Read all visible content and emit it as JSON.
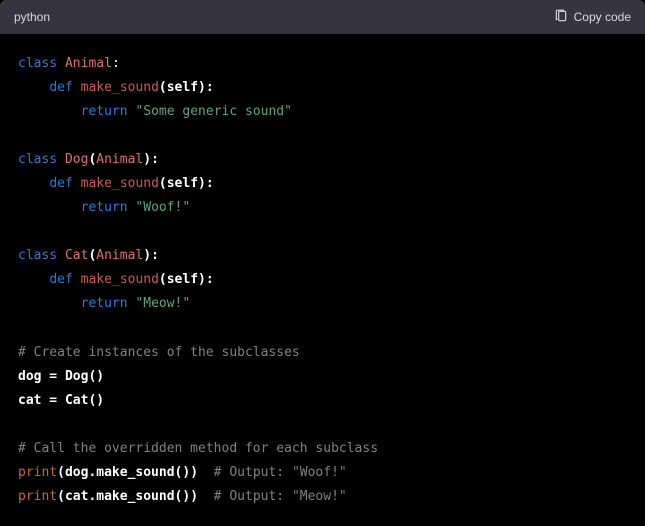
{
  "header": {
    "language": "python",
    "copy_label": "Copy code"
  },
  "code": {
    "l1_kw": "class",
    "l1_name": "Animal",
    "l1_colon": ":",
    "l2_kw": "def",
    "l2_name": "make_sound",
    "l2_open": "(",
    "l2_self": "self",
    "l2_close": "):",
    "l3_kw": "return",
    "l3_str": "\"Some generic sound\"",
    "l4_kw": "class",
    "l4_name": "Dog",
    "l4_open": "(",
    "l4_base": "Animal",
    "l4_close": "):",
    "l5_kw": "def",
    "l5_name": "make_sound",
    "l5_open": "(",
    "l5_self": "self",
    "l5_close": "):",
    "l6_kw": "return",
    "l6_str": "\"Woof!\"",
    "l7_kw": "class",
    "l7_name": "Cat",
    "l7_open": "(",
    "l7_base": "Animal",
    "l7_close": "):",
    "l8_kw": "def",
    "l8_name": "make_sound",
    "l8_open": "(",
    "l8_self": "self",
    "l8_close": "):",
    "l9_kw": "return",
    "l9_str": "\"Meow!\"",
    "l10_cmt": "# Create instances of the subclasses",
    "l11_lhs": "dog = Dog()",
    "l12_lhs": "cat = Cat()",
    "l13_cmt": "# Call the overridden method for each subclass",
    "l14_fn": "print",
    "l14_arg": "(dog.make_sound())",
    "l14_cmt": "  # Output: \"Woof!\"",
    "l15_fn": "print",
    "l15_arg": "(cat.make_sound())",
    "l15_cmt": "  # Output: \"Meow!\""
  }
}
